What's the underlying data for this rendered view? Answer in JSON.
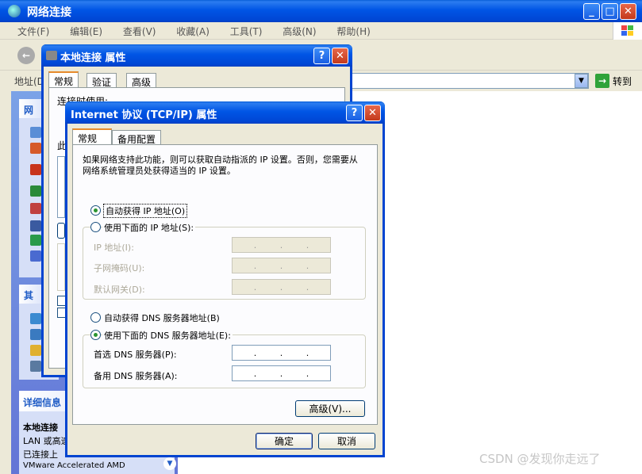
{
  "explorer": {
    "title": "网络连接",
    "menu": [
      "文件(F)",
      "编辑(E)",
      "查看(V)",
      "收藏(A)",
      "工具(T)",
      "高级(N)",
      "帮助(H)"
    ],
    "address_label": "地址(D)",
    "go_label": "转到",
    "sidebar_title_1": "网",
    "sidebar_title_2": "其",
    "details_title": "详细信息",
    "details_lines": [
      "本地连接",
      "LAN 或高速",
      "已连接上",
      "VMware Accelerated AMD"
    ]
  },
  "props_dialog": {
    "title": "本地连接 属性",
    "tabs": [
      "常规",
      "验证",
      "高级"
    ],
    "connect_using": "连接时使用:",
    "this_conn": "此"
  },
  "tcpip_dialog": {
    "title": "Internet 协议 (TCP/IP) 属性",
    "tabs": [
      "常规",
      "备用配置"
    ],
    "description": "如果网络支持此功能，则可以获取自动指派的 IP 设置。否则，您需要从网络系统管理员处获得适当的 IP 设置。",
    "auto_ip": "自动获得 IP 地址(O)",
    "manual_ip": "使用下面的 IP 地址(S):",
    "ip_label": "IP 地址(I):",
    "mask_label": "子网掩码(U):",
    "gateway_label": "默认网关(D):",
    "auto_dns": "自动获得 DNS 服务器地址(B)",
    "manual_dns": "使用下面的 DNS 服务器地址(E):",
    "pref_dns_label": "首选 DNS 服务器(P):",
    "alt_dns_label": "备用 DNS 服务器(A):",
    "advanced_label": "高级(V)...",
    "ok_label": "确定",
    "cancel_label": "取消",
    "ip_dots": ". . ."
  },
  "watermark": "CSDN @发现你走远了"
}
